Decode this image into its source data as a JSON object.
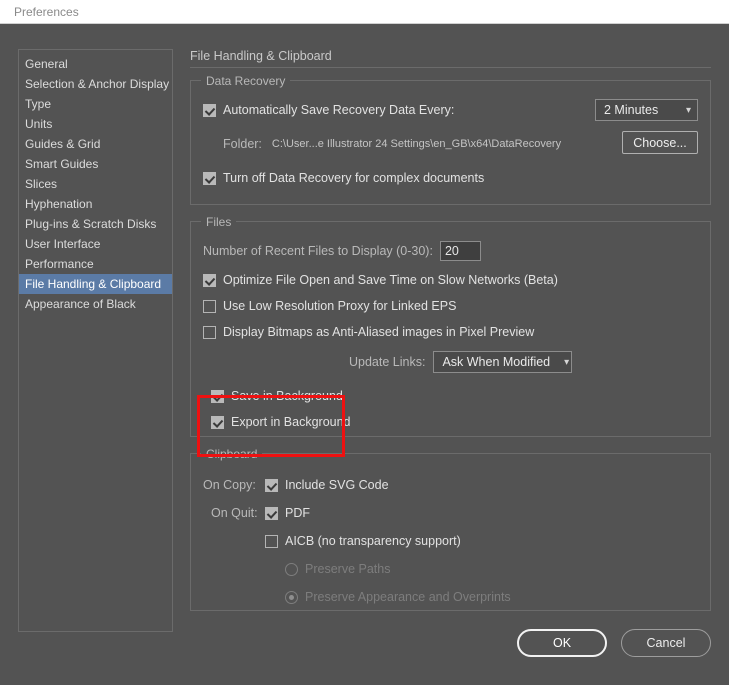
{
  "window": {
    "title": "Preferences"
  },
  "sidebar": {
    "items": [
      {
        "label": "General",
        "selected": false
      },
      {
        "label": "Selection & Anchor Display",
        "selected": false
      },
      {
        "label": "Type",
        "selected": false
      },
      {
        "label": "Units",
        "selected": false
      },
      {
        "label": "Guides & Grid",
        "selected": false
      },
      {
        "label": "Smart Guides",
        "selected": false
      },
      {
        "label": "Slices",
        "selected": false
      },
      {
        "label": "Hyphenation",
        "selected": false
      },
      {
        "label": "Plug-ins & Scratch Disks",
        "selected": false
      },
      {
        "label": "User Interface",
        "selected": false
      },
      {
        "label": "Performance",
        "selected": false
      },
      {
        "label": "File Handling & Clipboard",
        "selected": true
      },
      {
        "label": "Appearance of Black",
        "selected": false
      }
    ]
  },
  "pane": {
    "title": "File Handling & Clipboard"
  },
  "data_recovery": {
    "group_label": "Data Recovery",
    "auto_save_label": "Automatically Save Recovery Data Every:",
    "auto_save_checked": true,
    "interval_value": "2 Minutes",
    "folder_label": "Folder:",
    "folder_path": "C:\\User...e Illustrator 24 Settings\\en_GB\\x64\\DataRecovery",
    "choose_button": "Choose...",
    "turn_off_label": "Turn off Data Recovery for complex documents",
    "turn_off_checked": true
  },
  "files": {
    "group_label": "Files",
    "recent_files_label": "Number of Recent Files to Display (0-30):",
    "recent_files_value": "20",
    "optimize_label": "Optimize File Open and Save Time on Slow Networks (Beta)",
    "optimize_checked": true,
    "low_res_label": "Use Low Resolution Proxy for Linked EPS",
    "low_res_checked": false,
    "bitmaps_label": "Display Bitmaps as Anti-Aliased images in Pixel Preview",
    "bitmaps_checked": false,
    "update_links_label": "Update Links:",
    "update_links_value": "Ask When Modified",
    "save_bg_label": "Save in Background",
    "save_bg_checked": true,
    "export_bg_label": "Export in Background",
    "export_bg_checked": true
  },
  "clipboard": {
    "group_label": "Clipboard",
    "on_copy_label": "On Copy:",
    "on_quit_label": "On Quit:",
    "svg_label": "Include SVG Code",
    "svg_checked": true,
    "pdf_label": "PDF",
    "pdf_checked": true,
    "aicb_label": "AICB (no transparency support)",
    "aicb_checked": false,
    "preserve_paths_label": "Preserve Paths",
    "preserve_paths_selected": false,
    "preserve_appearance_label": "Preserve Appearance and Overprints",
    "preserve_appearance_selected": true
  },
  "footer": {
    "ok_label": "OK",
    "cancel_label": "Cancel"
  },
  "annotation": {
    "color": "#ee1111"
  }
}
